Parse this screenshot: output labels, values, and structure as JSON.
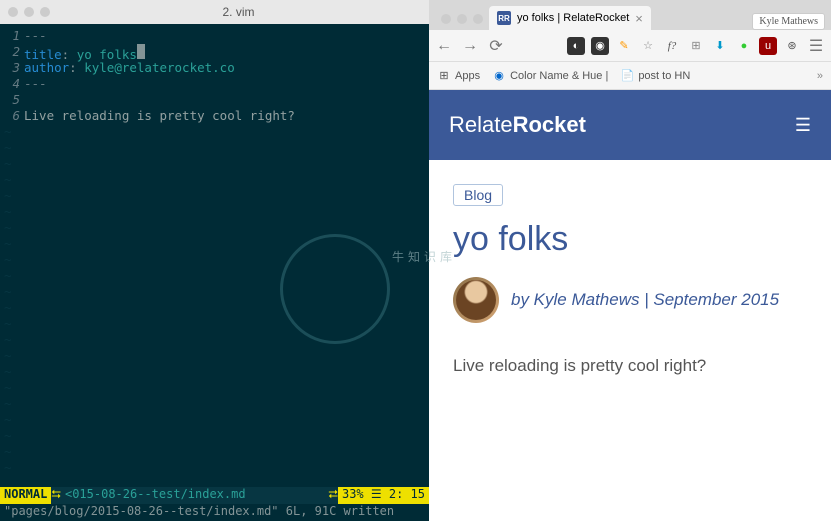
{
  "vim": {
    "title": "2. vim",
    "frontmatter_dashes": "---",
    "title_key": "title",
    "title_val": "yo folks",
    "author_key": "author",
    "author_val": "kyle@relaterocket.co",
    "body_line": "Live reloading is pretty cool right?",
    "gutter": {
      "l1": "1",
      "l2": "2",
      "l3": "3",
      "l4": "4",
      "l5": "5",
      "l6": "6"
    },
    "mode": " NORMAL ",
    "file": " <015-08-26--test/index.md ",
    "pos": " 33% ☰   2: 15",
    "msg": "\"pages/blog/2015-08-26--test/index.md\" 6L, 91C written"
  },
  "chrome": {
    "tab_title": "yo folks | RelateRocket",
    "favicon": "RR",
    "profile": " Kyle Mathews ",
    "bookmarks": {
      "apps": "Apps",
      "color": "Color Name & Hue |",
      "post": "post to HN"
    }
  },
  "site": {
    "logo_a": "Relate",
    "logo_b": "Rocket",
    "breadcrumb": "Blog",
    "post_title": "yo folks",
    "byline": "by Kyle Mathews | September 2015",
    "body": "Live reloading is pretty cool right?"
  },
  "watermark": "牛知识库"
}
